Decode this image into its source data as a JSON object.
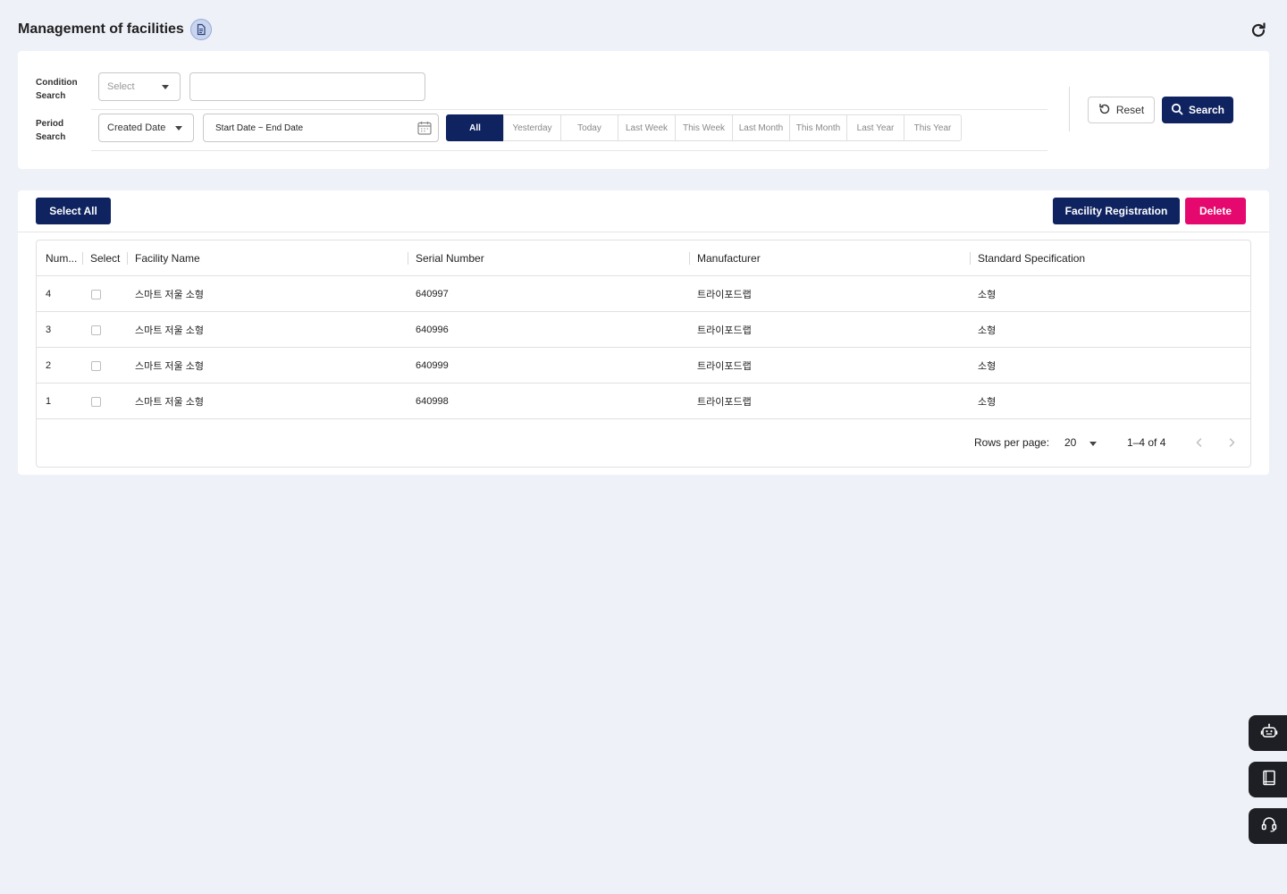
{
  "header": {
    "title": "Management of facilities"
  },
  "search": {
    "condition_label_1": "Condition",
    "condition_label_2": "Search",
    "condition_select_placeholder": "Select",
    "condition_input_value": "",
    "period_label_1": "Period",
    "period_label_2": "Search",
    "period_select_value": "Created Date",
    "date_range_placeholder": "Start Date ~ End Date",
    "period_buttons": [
      "All",
      "Yesterday",
      "Today",
      "Last Week",
      "This Week",
      "Last Month",
      "This Month",
      "Last Year",
      "This Year"
    ],
    "active_period": "All",
    "reset_label": "Reset",
    "search_label": "Search"
  },
  "toolbar": {
    "select_all_label": "Select All",
    "register_label": "Facility Registration",
    "delete_label": "Delete"
  },
  "table": {
    "columns": [
      "Num...",
      "Select",
      "Facility Name",
      "Serial Number",
      "Manufacturer",
      "Standard Specification"
    ],
    "rows": [
      {
        "num": "4",
        "name": "스마트 저울 소형",
        "serial": "640997",
        "manufacturer": "트라이포드랩",
        "spec": "소형"
      },
      {
        "num": "3",
        "name": "스마트 저울 소형",
        "serial": "640996",
        "manufacturer": "트라이포드랩",
        "spec": "소형"
      },
      {
        "num": "2",
        "name": "스마트 저울 소형",
        "serial": "640999",
        "manufacturer": "트라이포드랩",
        "spec": "소형"
      },
      {
        "num": "1",
        "name": "스마트 저울 소형",
        "serial": "640998",
        "manufacturer": "트라이포드랩",
        "spec": "소형"
      }
    ]
  },
  "pagination": {
    "rows_per_page_label": "Rows per page:",
    "rows_per_page_value": "20",
    "range_text": "1–4 of 4"
  },
  "colors": {
    "primary": "#0f2360",
    "danger": "#e5096f",
    "background": "#eef1f8"
  },
  "icons": [
    "document-icon",
    "refresh-icon",
    "chevron-down-icon",
    "calendar-icon",
    "reset-icon",
    "search-icon",
    "chevron-left-icon",
    "chevron-right-icon",
    "chatbot-icon",
    "manual-book-icon",
    "headset-icon"
  ]
}
